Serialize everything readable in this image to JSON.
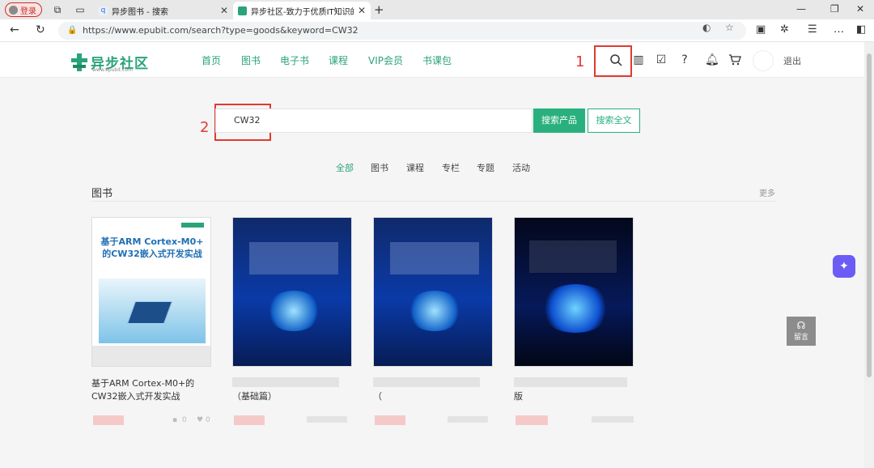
{
  "browser": {
    "login_label": "登录",
    "tabs": [
      {
        "label": "异步图书 - 搜索"
      },
      {
        "label": "异步社区-致力于优质IT知识的出版"
      }
    ],
    "url": "https://www.epubit.com/search?type=goods&keyword=CW32"
  },
  "site": {
    "logo_text": "异步社区",
    "logo_sub": "www.epubit.com",
    "nav": [
      "首页",
      "图书",
      "电子书",
      "课程",
      "VIP会员",
      "书课包"
    ],
    "logout_label": "退出"
  },
  "annotations": {
    "one": "1",
    "two": "2"
  },
  "search": {
    "value": "CW32",
    "product_button": "搜索产品",
    "fulltext_button": "搜索全文"
  },
  "categories": [
    "全部",
    "图书",
    "课程",
    "专栏",
    "专题",
    "活动"
  ],
  "section": {
    "title": "图书",
    "more": "更多"
  },
  "books": [
    {
      "title": "基于ARM Cortex-M0+的CW32嵌入式开发实战",
      "comments": "0",
      "likes": "0"
    },
    {
      "title": "（基础篇）"
    },
    {
      "title": "（"
    },
    {
      "title": "版"
    }
  ],
  "cover1": {
    "line1": "基于ARM Cortex-M0+",
    "line2": "的CW32嵌入式开发实战"
  },
  "float": {
    "message_label": "留言"
  },
  "colors": {
    "accent": "#2aa37a",
    "annotation": "#e03a31",
    "badge": "#6b5cf6"
  }
}
